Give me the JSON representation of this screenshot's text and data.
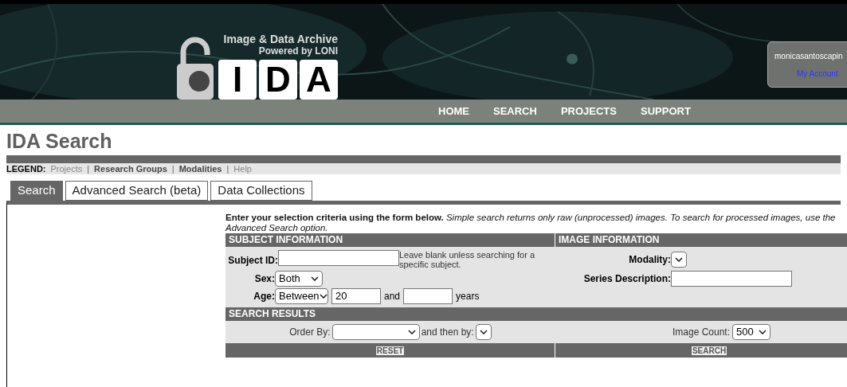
{
  "header": {
    "logo": {
      "line1": "Image & Data Archive",
      "line2": "Powered by LONI",
      "letters": [
        "I",
        "D",
        "A"
      ]
    },
    "account": {
      "user": "monicasantoscapin",
      "link": "My Account"
    }
  },
  "nav": [
    "HOME",
    "SEARCH",
    "PROJECTS",
    "SUPPORT"
  ],
  "page_title": "IDA Search",
  "legend": {
    "label": "LEGEND:",
    "separator": "|",
    "items": [
      {
        "text": "Projects",
        "bold": false
      },
      {
        "text": "Research Groups",
        "bold": true
      },
      {
        "text": "Modalities",
        "bold": true
      },
      {
        "text": "Help",
        "bold": false
      }
    ]
  },
  "tabs": [
    {
      "label": "Search",
      "selected": true
    },
    {
      "label": "Advanced Search (beta)",
      "selected": false
    },
    {
      "label": "Data Collections",
      "selected": false
    }
  ],
  "intro": "**Enter your selection criteria using the form below.** *Simple search returns only raw (unprocessed) images. To search for processed images, use the Advanced Search option.*",
  "subject_information": {
    "heading": "SUBJECT INFORMATION",
    "subject_id": {
      "label": "Subject ID:",
      "hint": "Leave blank unless searching for a specific subject."
    },
    "sex": {
      "label": "Sex:",
      "value": "Both"
    },
    "age": {
      "label": "Age:",
      "mode": "Between",
      "from": "20",
      "and": "and",
      "years": "years"
    }
  },
  "image_information": {
    "heading": "IMAGE INFORMATION",
    "modality": {
      "label": "Modality:"
    },
    "series_description": {
      "label": "Series Description:"
    }
  },
  "search_results": {
    "heading": "SEARCH RESULTS",
    "order_by": {
      "label": "Order By:"
    },
    "then_by": {
      "label": "and then by:"
    },
    "image_count": {
      "label": "Image Count:",
      "value": "500"
    }
  },
  "buttons": [
    "RESET",
    "SEARCH"
  ]
}
